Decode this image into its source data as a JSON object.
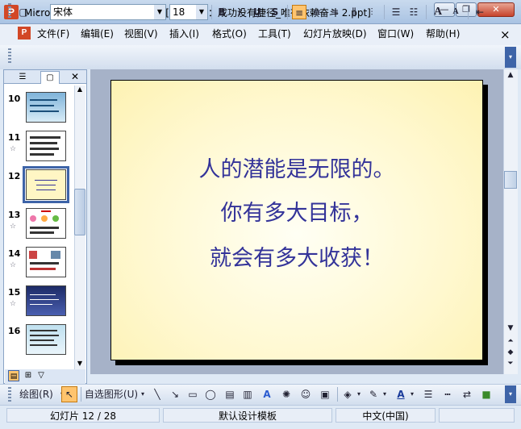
{
  "window": {
    "title": "Microsoft Office PowerPoint - [主题班会：成功没有捷径_唯有依赖奋斗 2.ppt]",
    "app_icon": "powerpoint-icon",
    "controls": {
      "minimize": "—",
      "restore": "❐",
      "close": "✕"
    }
  },
  "menu": {
    "items": [
      "文件(F)",
      "编辑(E)",
      "视图(V)",
      "插入(I)",
      "格式(O)",
      "工具(T)",
      "幻灯片放映(D)",
      "窗口(W)",
      "帮助(H)"
    ],
    "close_glyph": "×"
  },
  "format_toolbar": {
    "font": "宋体",
    "font_size": "18",
    "bold": "B",
    "italic": "I",
    "underline": "U",
    "shadow": "S",
    "align_left": "≡",
    "align_center": "≡",
    "align_right": "≡",
    "grow_font": "A",
    "shrink_font": "A"
  },
  "outline_panel": {
    "tabs": [
      "outline-tab-icon",
      "slides-tab-icon"
    ],
    "close_glyph": "✕",
    "thumbnails": [
      {
        "number": "10",
        "style": "dark"
      },
      {
        "number": "11",
        "style": "text"
      },
      {
        "number": "12",
        "style": "selected"
      },
      {
        "number": "13",
        "style": "icons"
      },
      {
        "number": "14",
        "style": "mixed"
      },
      {
        "number": "15",
        "style": "dark"
      },
      {
        "number": "16",
        "style": "text"
      }
    ]
  },
  "slide": {
    "lines": [
      "人的潜能是无限的。",
      "你有多大目标，",
      "就会有多大收获！"
    ],
    "text_color": "#333399",
    "background_color": "#fff8cf"
  },
  "drawing_toolbar": {
    "draw_menu": "绘图(R)",
    "autoshapes": "自选图形(U)",
    "font_color_label": "A"
  },
  "status": {
    "slide_info": "幻灯片 12 / 28",
    "design": "默认设计模板",
    "language": "中文(中国)"
  }
}
